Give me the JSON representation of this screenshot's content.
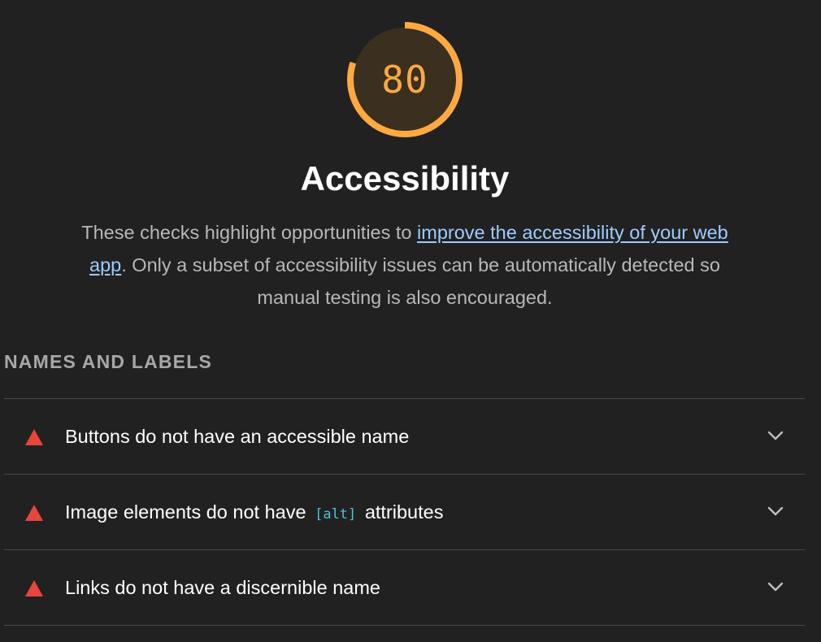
{
  "gauge": {
    "score": "80",
    "fraction": 0.8,
    "color": "#ffa940",
    "fill_color": "#3b2f1f"
  },
  "category": {
    "title": "Accessibility",
    "description_before": "These checks highlight opportunities to ",
    "description_link": "improve the accessibility of your web app",
    "description_after": ". Only a subset of accessibility issues can be automatically detected so manual testing is also encouraged."
  },
  "group": {
    "title": "NAMES AND LABELS"
  },
  "audits": [
    {
      "status": "fail",
      "icon": "warning-triangle-icon",
      "title": "Buttons do not have an accessible name",
      "code": "",
      "title_after": ""
    },
    {
      "status": "fail",
      "icon": "warning-triangle-icon",
      "title": "Image elements do not have",
      "code": "[alt]",
      "title_after": "attributes"
    },
    {
      "status": "fail",
      "icon": "warning-triangle-icon",
      "title": "Links do not have a discernible name",
      "code": "",
      "title_after": ""
    }
  ],
  "colors": {
    "background": "#212121",
    "fail": "#e8453c",
    "link": "#9ecbff",
    "code": "#4fc3d4"
  }
}
